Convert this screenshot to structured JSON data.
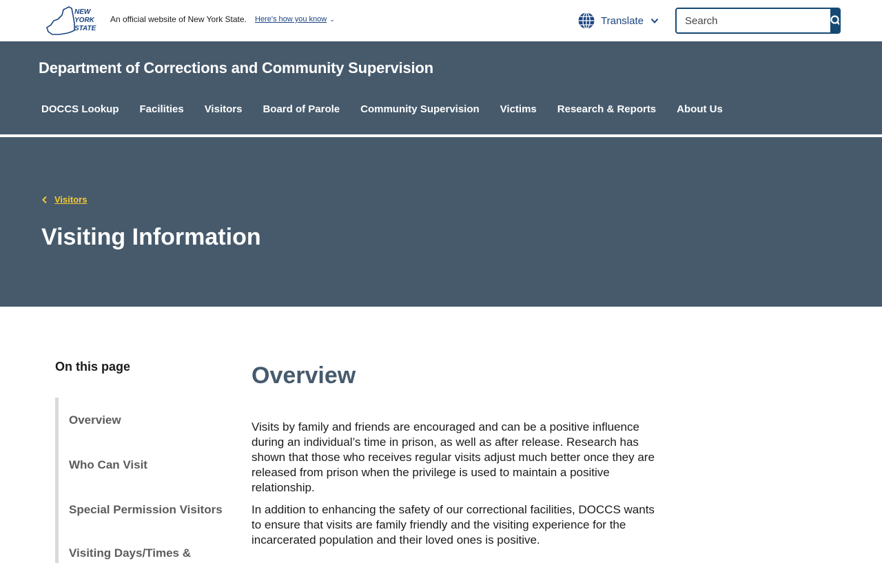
{
  "topbar": {
    "logo_text": "NEW YORK STATE",
    "official_text": "An official website of New York State.",
    "how_you_know": "Here's how you know",
    "translate_label": "Translate",
    "search_placeholder": "Search"
  },
  "agency": {
    "name": "Department of Corrections and Community Supervision"
  },
  "nav": {
    "items": [
      "DOCCS Lookup",
      "Facilities",
      "Visitors",
      "Board of Parole",
      "Community Supervision",
      "Victims",
      "Research & Reports",
      "About Us"
    ]
  },
  "hero": {
    "breadcrumb": "Visitors",
    "title": "Visiting Information"
  },
  "on_this_page": {
    "heading": "On this page",
    "items": [
      "Overview",
      "Who Can Visit",
      "Special Permission Visitors",
      "Visiting Days/Times &"
    ]
  },
  "content": {
    "title": "Overview",
    "paragraphs": [
      "Visits by family and friends are encouraged and can be a positive influence during an individual’s time in prison, as well as after release. Research has shown that those who receives regular visits adjust much better once they are released from prison when the privilege is used to maintain a positive relationship.",
      "In addition to enhancing the safety of our correctional facilities, DOCCS wants to ensure that visits are family friendly and the visiting experience for the incarcerated population and their loved ones is positive."
    ]
  },
  "colors": {
    "header_bg": "#465a6c",
    "brand_blue": "#154973",
    "breadcrumb_gold": "#f8c932"
  }
}
